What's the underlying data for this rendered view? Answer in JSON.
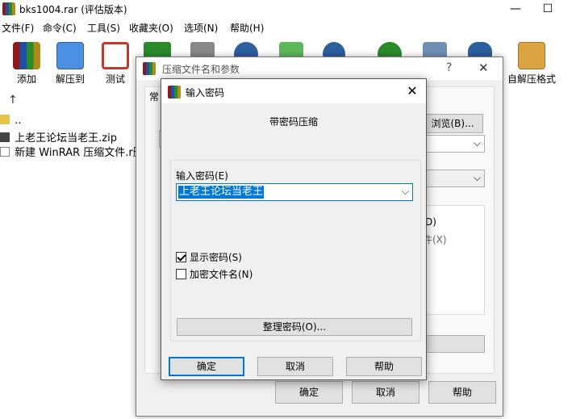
{
  "window": {
    "title": "bks1004.rar (评估版本)"
  },
  "window_controls": {
    "minimize": "—",
    "maximize": "☐"
  },
  "menu": [
    {
      "label": "文件(F)"
    },
    {
      "label": "命令(C)"
    },
    {
      "label": "工具(S)"
    },
    {
      "label": "收藏夹(O)"
    },
    {
      "label": "选项(N)"
    },
    {
      "label": "帮助(H)"
    }
  ],
  "toolbar": [
    {
      "label": "添加",
      "icon": "add-archive-icon",
      "color": "#c0392b"
    },
    {
      "label": "解压到",
      "icon": "folder-extract-icon",
      "color": "#3a7bd5"
    },
    {
      "label": "测试",
      "icon": "test-clipboard-icon",
      "color": "#c0392b"
    },
    {
      "label": "自解压格式",
      "icon": "sfx-box-icon",
      "color": "#d9a441"
    }
  ],
  "files": [
    {
      "name": "..",
      "type": "folder"
    },
    {
      "name": "上老王论坛当老王.zip",
      "type": "zip"
    },
    {
      "name": "新建 WinRAR 压缩文件.r删除",
      "type": "doc"
    }
  ],
  "back_dialog": {
    "title": "压缩文件名和参数",
    "help_glyph": "?",
    "close_glyph": "✕",
    "tab_fragment": "常",
    "browse_label": "浏览(B)...",
    "option_d": "D)",
    "option_x": "件(X)",
    "ok_label": "确定",
    "cancel_label": "取消",
    "help_label": "帮助"
  },
  "front_dialog": {
    "title": "输入密码",
    "close_glyph": "✕",
    "heading": "带密码压缩",
    "password_label": "输入密码(E)",
    "password_value": "上老王论坛当老王",
    "show_password_label": "显示密码(S)",
    "show_password_checked": true,
    "encrypt_filenames_label": "加密文件名(N)",
    "encrypt_filenames_checked": false,
    "organize_label": "整理密码(O)...",
    "ok_label": "确定",
    "cancel_label": "取消",
    "help_label": "帮助"
  }
}
